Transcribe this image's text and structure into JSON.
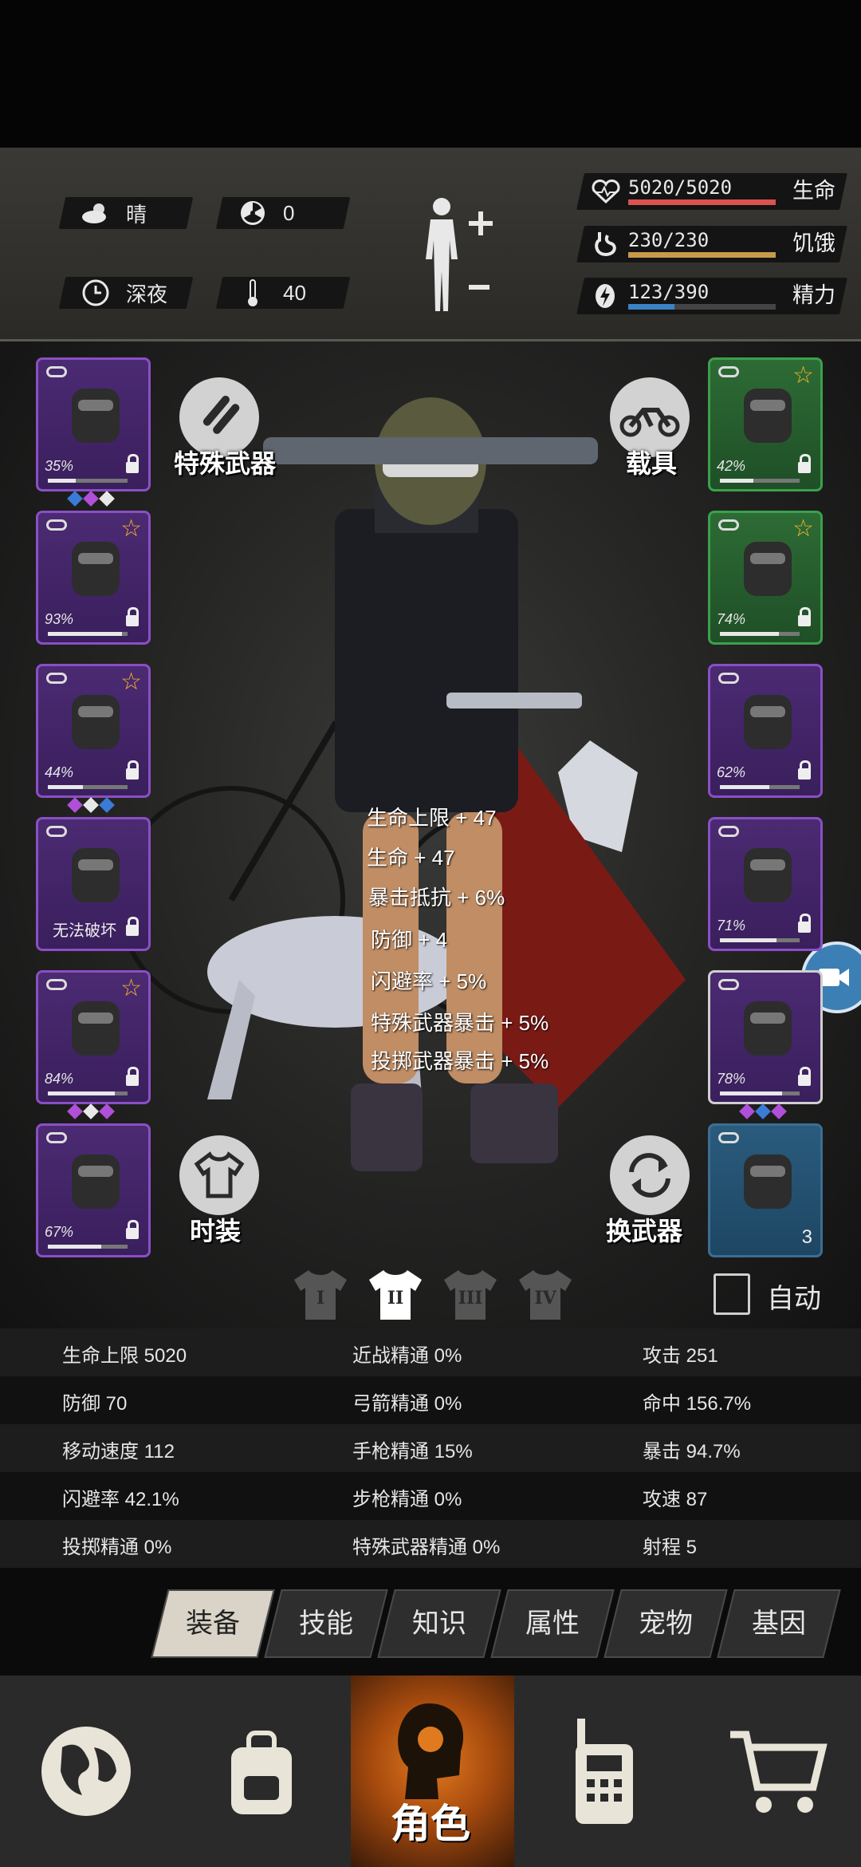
{
  "status": {
    "weather": {
      "icon": "cloud-sun-icon",
      "label": "晴"
    },
    "radiation": {
      "icon": "radiation-icon",
      "value": "0"
    },
    "time": {
      "icon": "clock-icon",
      "label": "深夜"
    },
    "temperature": {
      "icon": "thermometer-icon",
      "value": "40"
    },
    "health": {
      "value": "5020/5020",
      "label": "生命",
      "fraction": 1.0,
      "color": "#d9534f"
    },
    "hunger": {
      "value": "230/230",
      "label": "饥饿",
      "fraction": 1.0,
      "color": "#c89a4a"
    },
    "energy": {
      "value": "123/390",
      "label": "精力",
      "fraction": 0.315,
      "color": "#3a83c4"
    }
  },
  "buttons": {
    "special_weapon": "特殊武器",
    "vehicle": "载具",
    "fashion": "时装",
    "switch_weapon": "换武器",
    "auto": "自动"
  },
  "left_slots": [
    {
      "name": "helmet",
      "pct": "35%",
      "durability": 0.35,
      "gems": [
        "#3a7bd5",
        "#b04fd8",
        "#e8e8e8"
      ],
      "star": false
    },
    {
      "name": "shirt",
      "pct": "93%",
      "durability": 0.93,
      "star": true
    },
    {
      "name": "jacket",
      "pct": "44%",
      "durability": 0.44,
      "gems": [
        "#b04fd8",
        "#e8e8e8",
        "#3a7bd5"
      ],
      "star": true
    },
    {
      "name": "backpack",
      "note": "无法破坏",
      "star": false
    },
    {
      "name": "pants",
      "pct": "84%",
      "durability": 0.84,
      "gems": [
        "#b04fd8",
        "#e8e8e8",
        "#b04fd8"
      ],
      "star": true
    },
    {
      "name": "boots",
      "pct": "67%",
      "durability": 0.67,
      "star": false
    }
  ],
  "right_slots": [
    {
      "name": "glasses",
      "pct": "42%",
      "durability": 0.42,
      "star": true
    },
    {
      "name": "mask",
      "pct": "74%",
      "durability": 0.74,
      "star": true
    },
    {
      "name": "vest",
      "pct": "62%",
      "durability": 0.62,
      "star": false
    },
    {
      "name": "shield",
      "pct": "71%",
      "durability": 0.71,
      "star": false
    },
    {
      "name": "revolver",
      "pct": "78%",
      "durability": 0.78,
      "gems": [
        "#b04fd8",
        "#3a7bd5",
        "#b04fd8"
      ],
      "star": false
    },
    {
      "name": "pouch",
      "count": "3",
      "star": false
    }
  ],
  "outfit_slots": [
    "I",
    "II",
    "III",
    "IV"
  ],
  "float_text": [
    "生命上限 + 47",
    "生命 + 47",
    "暴击抵抗 + 6%",
    "防御 + 4",
    "闪避率 + 5%",
    "特殊武器暴击 + 5%",
    "投掷武器暴击 + 5%"
  ],
  "stats": [
    [
      "生命上限 5020",
      "近战精通 0%",
      "攻击 251"
    ],
    [
      "防御 70",
      "弓箭精通 0%",
      "命中 156.7%"
    ],
    [
      "移动速度 112",
      "手枪精通 15%",
      "暴击 94.7%"
    ],
    [
      "闪避率 42.1%",
      "步枪精通 0%",
      "攻速 87"
    ],
    [
      "投掷精通 0%",
      "特殊武器精通 0%",
      "射程 5"
    ]
  ],
  "tabs": [
    "装备",
    "技能",
    "知识",
    "属性",
    "宠物",
    "基因"
  ],
  "nav": [
    {
      "icon": "globe-icon",
      "label": ""
    },
    {
      "icon": "backpack-icon",
      "label": ""
    },
    {
      "icon": "character-icon",
      "label": "角色"
    },
    {
      "icon": "radio-icon",
      "label": ""
    },
    {
      "icon": "cart-icon",
      "label": ""
    }
  ]
}
